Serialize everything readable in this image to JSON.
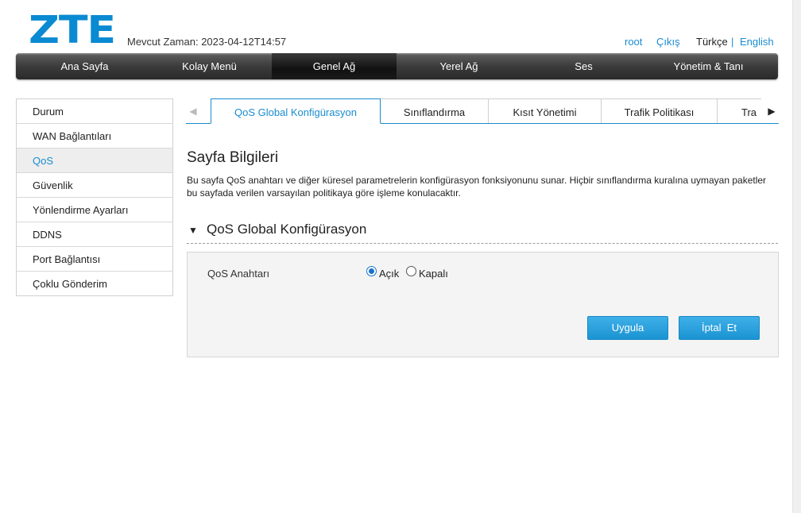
{
  "brand": {
    "logo": "ZTE",
    "logo_color": "#0a8ad2"
  },
  "header": {
    "time_label": "Mevcut Zaman: 2023-04-12T14:57",
    "user": "root",
    "logout": "Çıkış",
    "lang_tr": "Türkçe",
    "lang_sep": "|",
    "lang_en": "English"
  },
  "nav": {
    "active": "Genel Ağ",
    "items": [
      "Ana Sayfa",
      "Kolay Menü",
      "Genel Ağ",
      "Yerel Ağ",
      "Ses",
      "Yönetim & Tanı"
    ]
  },
  "sidebar": {
    "active": "QoS",
    "items": [
      "Durum",
      "WAN Bağlantıları",
      "QoS",
      "Güvenlik",
      "Yönlendirme Ayarları",
      "DDNS",
      "Port Bağlantısı",
      "Çoklu Gönderim"
    ]
  },
  "tabs": {
    "left_arrow": "◀",
    "right_arrow": "▶",
    "active": "QoS Global Konfigürasyon",
    "items": [
      "QoS Global Konfigürasyon",
      "Sınıflandırma",
      "Kısıt Yönetimi",
      "Trafik Politikası",
      "Tra"
    ]
  },
  "page": {
    "title": "Sayfa Bilgileri",
    "description": "Bu sayfa QoS anahtarı ve diğer küresel parametrelerin konfigürasyon fonksiyonunu sunar. Hiçbir sınıflandırma kuralına uymayan paketler bu sayfada verilen varsayılan politikaya göre işleme konulacaktır."
  },
  "section": {
    "toggle_icon": "▼",
    "title": "QoS Global Konfigürasyon"
  },
  "form": {
    "qos_switch_label": "QoS Anahtarı",
    "options": [
      "Açık",
      "Kapalı"
    ],
    "selected": "Açık",
    "apply": "Uygula",
    "cancel": "İptal  Et"
  },
  "colors": {
    "accent": "#1a8ccf",
    "button": "#1b93d3"
  }
}
